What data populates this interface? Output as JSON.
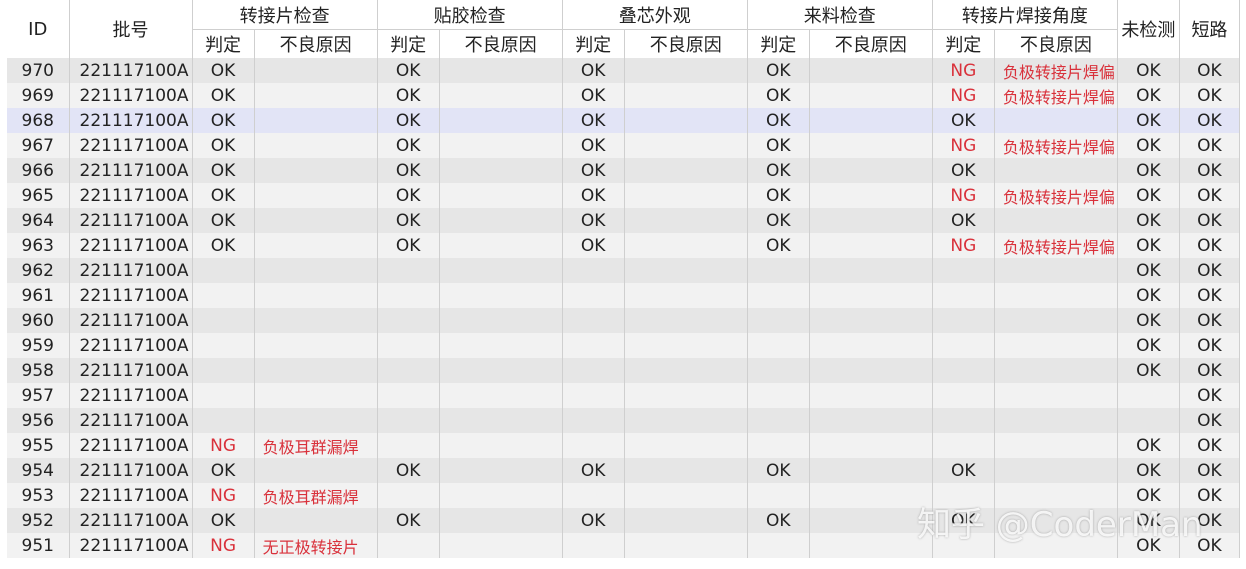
{
  "header": {
    "id": "ID",
    "batch": "批号",
    "judge": "判定",
    "reason": "不良原因",
    "groups": [
      "转接片检查",
      "贴胶检查",
      "叠芯外观",
      "来料检查",
      "转接片焊接角度"
    ],
    "not_inspected": "未检测",
    "short_circuit": "短路"
  },
  "rows": [
    {
      "id": "970",
      "batch": "221117100A",
      "c": [
        "OK",
        "",
        "OK",
        "",
        "OK",
        "",
        "OK",
        "",
        "NG",
        "负极转接片焊偏",
        "OK",
        "OK"
      ]
    },
    {
      "id": "969",
      "batch": "221117100A",
      "c": [
        "OK",
        "",
        "OK",
        "",
        "OK",
        "",
        "OK",
        "",
        "NG",
        "负极转接片焊偏",
        "OK",
        "OK"
      ]
    },
    {
      "id": "968",
      "batch": "221117100A",
      "c": [
        "OK",
        "",
        "OK",
        "",
        "OK",
        "",
        "OK",
        "",
        "OK",
        "",
        "OK",
        "OK"
      ]
    },
    {
      "id": "967",
      "batch": "221117100A",
      "c": [
        "OK",
        "",
        "OK",
        "",
        "OK",
        "",
        "OK",
        "",
        "NG",
        "负极转接片焊偏",
        "OK",
        "OK"
      ]
    },
    {
      "id": "966",
      "batch": "221117100A",
      "c": [
        "OK",
        "",
        "OK",
        "",
        "OK",
        "",
        "OK",
        "",
        "OK",
        "",
        "OK",
        "OK"
      ]
    },
    {
      "id": "965",
      "batch": "221117100A",
      "c": [
        "OK",
        "",
        "OK",
        "",
        "OK",
        "",
        "OK",
        "",
        "NG",
        "负极转接片焊偏",
        "OK",
        "OK"
      ]
    },
    {
      "id": "964",
      "batch": "221117100A",
      "c": [
        "OK",
        "",
        "OK",
        "",
        "OK",
        "",
        "OK",
        "",
        "OK",
        "",
        "OK",
        "OK"
      ]
    },
    {
      "id": "963",
      "batch": "221117100A",
      "c": [
        "OK",
        "",
        "OK",
        "",
        "OK",
        "",
        "OK",
        "",
        "NG",
        "负极转接片焊偏",
        "OK",
        "OK"
      ]
    },
    {
      "id": "962",
      "batch": "221117100A",
      "c": [
        "",
        "",
        "",
        "",
        "",
        "",
        "",
        "",
        "",
        "",
        "OK",
        "OK"
      ]
    },
    {
      "id": "961",
      "batch": "221117100A",
      "c": [
        "",
        "",
        "",
        "",
        "",
        "",
        "",
        "",
        "",
        "",
        "OK",
        "OK"
      ]
    },
    {
      "id": "960",
      "batch": "221117100A",
      "c": [
        "",
        "",
        "",
        "",
        "",
        "",
        "",
        "",
        "",
        "",
        "OK",
        "OK"
      ]
    },
    {
      "id": "959",
      "batch": "221117100A",
      "c": [
        "",
        "",
        "",
        "",
        "",
        "",
        "",
        "",
        "",
        "",
        "OK",
        "OK"
      ]
    },
    {
      "id": "958",
      "batch": "221117100A",
      "c": [
        "",
        "",
        "",
        "",
        "",
        "",
        "",
        "",
        "",
        "",
        "OK",
        "OK"
      ]
    },
    {
      "id": "957",
      "batch": "221117100A",
      "c": [
        "",
        "",
        "",
        "",
        "",
        "",
        "",
        "",
        "",
        "",
        "",
        "OK"
      ]
    },
    {
      "id": "956",
      "batch": "221117100A",
      "c": [
        "",
        "",
        "",
        "",
        "",
        "",
        "",
        "",
        "",
        "",
        "",
        "OK"
      ]
    },
    {
      "id": "955",
      "batch": "221117100A",
      "c": [
        "NG",
        "负极耳群漏焊",
        "",
        "",
        "",
        "",
        "",
        "",
        "",
        "",
        "OK",
        "OK"
      ]
    },
    {
      "id": "954",
      "batch": "221117100A",
      "c": [
        "OK",
        "",
        "OK",
        "",
        "OK",
        "",
        "OK",
        "",
        "OK",
        "",
        "OK",
        "OK"
      ]
    },
    {
      "id": "953",
      "batch": "221117100A",
      "c": [
        "NG",
        "负极耳群漏焊",
        "",
        "",
        "",
        "",
        "",
        "",
        "",
        "",
        "OK",
        "OK"
      ]
    },
    {
      "id": "952",
      "batch": "221117100A",
      "c": [
        "OK",
        "",
        "OK",
        "",
        "OK",
        "",
        "OK",
        "",
        "OK",
        "",
        "OK",
        "OK"
      ]
    },
    {
      "id": "951",
      "batch": "221117100A",
      "c": [
        "NG",
        "无正极转接片",
        "",
        "",
        "",
        "",
        "",
        "",
        "",
        "",
        "OK",
        "OK"
      ]
    }
  ],
  "highlight_row_id": "968",
  "watermark": "知乎 @CoderMan",
  "colors": {
    "ng": "#d9313b",
    "row_odd": "#e6e6e6",
    "row_even": "#f2f2f2",
    "row_highlight": "#e2e4f6",
    "grid": "#cfcfcf"
  }
}
